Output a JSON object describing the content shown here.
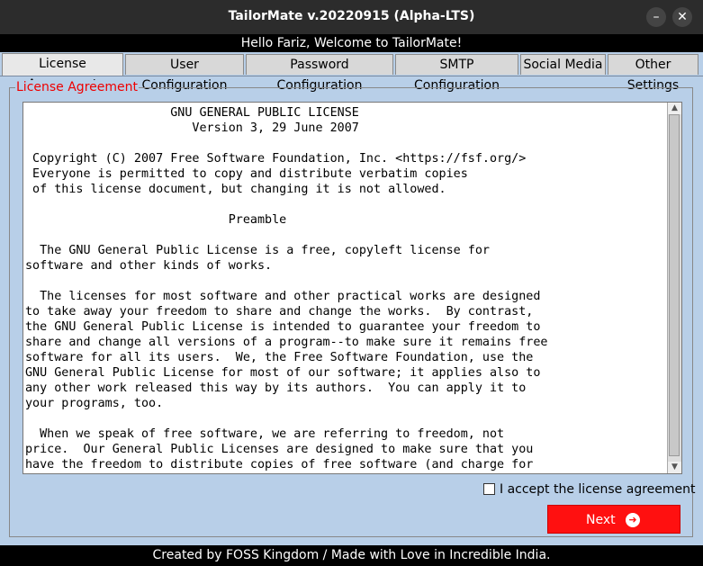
{
  "window": {
    "title": "TailorMate v.20220915 (Alpha-LTS)",
    "minimize_glyph": "–",
    "close_glyph": "✕"
  },
  "welcome": "Hello Fariz, Welcome to TailorMate!",
  "tabs": [
    {
      "label": "License Agreement",
      "active": true
    },
    {
      "label": "User Configuration"
    },
    {
      "label": "Password Configuration"
    },
    {
      "label": "SMTP Configuration"
    },
    {
      "label": "Social Media"
    },
    {
      "label": "Other Settings"
    }
  ],
  "license_group": {
    "legend": "License Agreement",
    "legend_color": "#ee0000",
    "text": "                    GNU GENERAL PUBLIC LICENSE\n                       Version 3, 29 June 2007\n\n Copyright (C) 2007 Free Software Foundation, Inc. <https://fsf.org/>\n Everyone is permitted to copy and distribute verbatim copies\n of this license document, but changing it is not allowed.\n\n                            Preamble\n\n  The GNU General Public License is a free, copyleft license for\nsoftware and other kinds of works.\n\n  The licenses for most software and other practical works are designed\nto take away your freedom to share and change the works.  By contrast,\nthe GNU General Public License is intended to guarantee your freedom to\nshare and change all versions of a program--to make sure it remains free\nsoftware for all its users.  We, the Free Software Foundation, use the\nGNU General Public License for most of our software; it applies also to\nany other work released this way by its authors.  You can apply it to\nyour programs, too.\n\n  When we speak of free software, we are referring to freedom, not\nprice.  Our General Public Licenses are designed to make sure that you\nhave the freedom to distribute copies of free software (and charge for"
  },
  "accept_checkbox": {
    "label": "I accept the license agreement",
    "checked": false
  },
  "next_button": {
    "label": "Next",
    "icon": "arrow-right-circle-icon",
    "color": "#ff1010"
  },
  "footer": "Created by FOSS Kingdom / Made with Love in Incredible India."
}
